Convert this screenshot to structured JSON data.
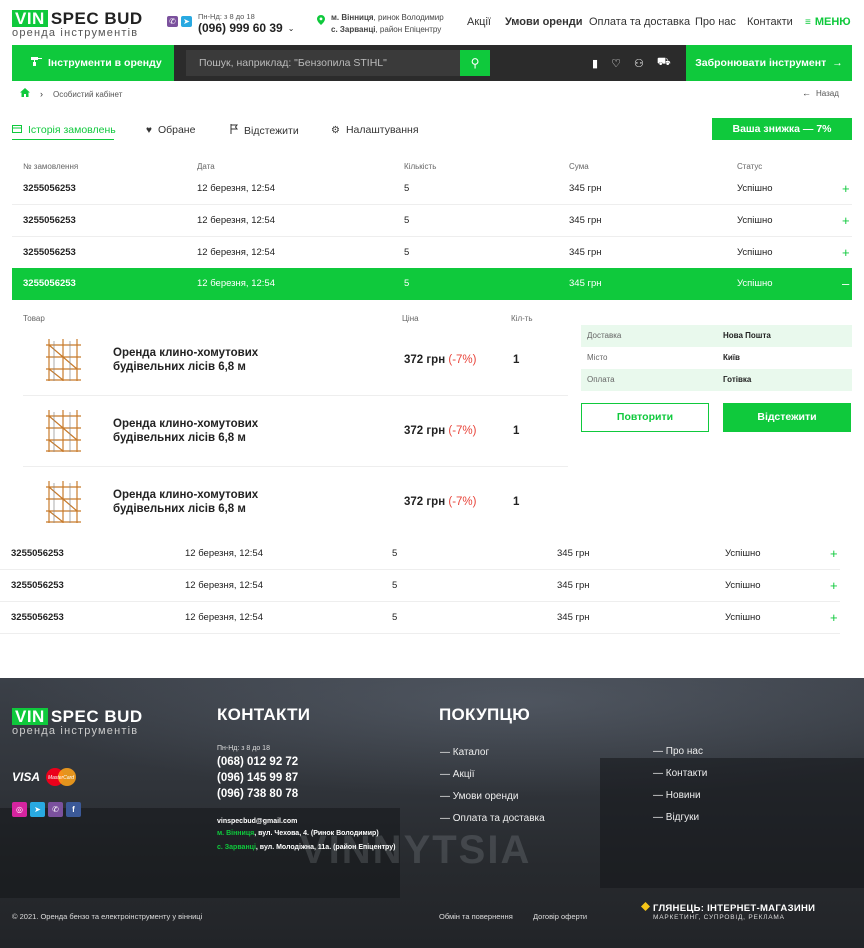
{
  "header": {
    "logo_vin": "VIN",
    "logo_spec": "SPEC BUD",
    "logo_sub": "оренда інструментів",
    "hours": "Пн-Нд: з 8 до 18",
    "phone": "(096) 999 60 39",
    "address_line1_bold": "м. Вінниця",
    "address_line1_rest": ", ринок Володимир",
    "address_line2_bold": "с. Зарванці",
    "address_line2_rest": ", район  Епіцентру",
    "nav": [
      "Акції",
      "Умови оренди",
      "Оплата та доставка",
      "Про нас",
      "Контакти"
    ],
    "menu_label": "МЕНЮ"
  },
  "bar": {
    "rent_label": "Інструменти в оренду",
    "search_placeholder": "Пошук, наприклад: \"Бензопила STIHL\"",
    "book_label": "Забронювати інструмент"
  },
  "breadcrumb": {
    "current": "Особистий кабінет",
    "back": "Назад"
  },
  "tabs": [
    {
      "label": "Історія замовлень",
      "icon": "list-icon"
    },
    {
      "label": "Обране",
      "icon": "heart-icon"
    },
    {
      "label": "Відстежити",
      "icon": "flag-icon"
    },
    {
      "label": "Налаштування",
      "icon": "gear-icon"
    }
  ],
  "discount_label": "Ваша знижка — 7%",
  "table": {
    "headers": [
      "№ замовлення",
      "Дата",
      "Кількість",
      "Сума",
      "Статус"
    ],
    "rows": [
      {
        "num": "3255056253",
        "date": "12 березня, 12:54",
        "qty": "5",
        "sum": "345 грн",
        "status": "Успішно",
        "toggle": "+"
      },
      {
        "num": "3255056253",
        "date": "12 березня, 12:54",
        "qty": "5",
        "sum": "345 грн",
        "status": "Успішно",
        "toggle": "+"
      },
      {
        "num": "3255056253",
        "date": "12 березня, 12:54",
        "qty": "5",
        "sum": "345 грн",
        "status": "Успішно",
        "toggle": "+"
      },
      {
        "num": "3255056253",
        "date": "12 березня, 12:54",
        "qty": "5",
        "sum": "345 грн",
        "status": "Успішно",
        "toggle": "–"
      },
      {
        "num": "3255056253",
        "date": "12 березня, 12:54",
        "qty": "5",
        "sum": "345 грн",
        "status": "Успішно",
        "toggle": "+"
      },
      {
        "num": "3255056253",
        "date": "12 березня, 12:54",
        "qty": "5",
        "sum": "345 грн",
        "status": "Успішно",
        "toggle": "+"
      },
      {
        "num": "3255056253",
        "date": "12 березня, 12:54",
        "qty": "5",
        "sum": "345 грн",
        "status": "Успішно",
        "toggle": "+"
      }
    ]
  },
  "details": {
    "headers": [
      "Товар",
      "Ціна",
      "Кіл-ть"
    ],
    "items": [
      {
        "name1": "Оренда клино-хомутових",
        "name2": "будівельних лісів 6,8 м",
        "price": "372 грн",
        "discount": "(-7%)",
        "qty": "1"
      },
      {
        "name1": "Оренда клино-хомутових",
        "name2": "будівельних лісів 6,8 м",
        "price": "372 грн",
        "discount": "(-7%)",
        "qty": "1"
      },
      {
        "name1": "Оренда клино-хомутових",
        "name2": "будівельних лісів 6,8 м",
        "price": "372 грн",
        "discount": "(-7%)",
        "qty": "1"
      }
    ],
    "info": [
      {
        "key": "Доставка",
        "value": "Нова Пошта"
      },
      {
        "key": "Місто",
        "value": "Київ"
      },
      {
        "key": "Оплата",
        "value": "Готівка"
      }
    ],
    "repeat_label": "Повторити",
    "track_label": "Відстежити"
  },
  "footer": {
    "logo_vin": "VIN",
    "logo_spec": "SPEC BUD",
    "logo_sub": "оренда інструментів",
    "visa": "VISA",
    "mastercard": "MasterCard",
    "contacts_title": "КОНТАКТИ",
    "hours": "Пн-Нд: з 8 до 18",
    "phones": [
      "(068) 012 92 72",
      "(096) 145 99 87",
      "(096) 738 80 78"
    ],
    "email": "vinspecbud@gmail.com",
    "addr1_green": "м. Вінниця",
    "addr1_rest": ", вул. Чехова, 4. (Ринок Володимир)",
    "addr2_green": "с. Зарванці",
    "addr2_rest": ", вул. Молодіжна, 11а. (район  Епіцентру)",
    "buyer_title": "ПОКУПЦЮ",
    "links_col1": [
      "Каталог",
      "Акції",
      "Умови оренди",
      "Оплата та доставка"
    ],
    "links_col2": [
      "Про нас",
      "Контакти",
      "Новини",
      "Відгуки"
    ],
    "copyright": "© 2021. Оренда бензо та електроінструменту у вінниці",
    "bottom_links": [
      "Обмін та повернення",
      "Договір оферти"
    ],
    "dev_title": "ГЛЯНЕЦЬ: ІНТЕРНЕТ-МАГАЗИНИ",
    "dev_sub": "МАРКЕТИНГ, СУПРОВІД, РЕКЛАМА",
    "bg_text": "VINNYTSIA"
  },
  "colors": {
    "accent": "#0fc93c",
    "dark": "#2b2b2b",
    "discount": "#e8443a"
  }
}
